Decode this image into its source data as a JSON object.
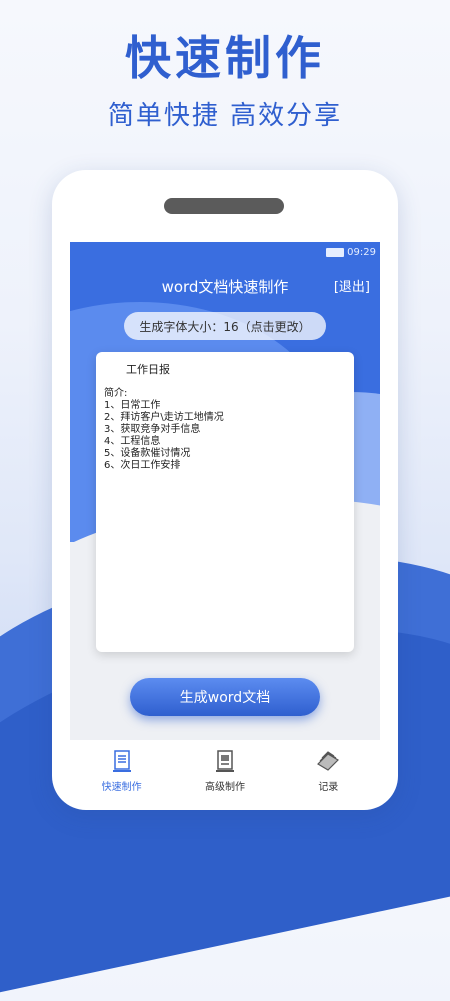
{
  "hero": {
    "title": "快速制作",
    "subtitle": "简单快捷 高效分享"
  },
  "status_bar": {
    "time": "09:29",
    "icons": [
      "battery-icon"
    ]
  },
  "app_bar": {
    "title": "word文档快速制作",
    "exit_label": "[退出]"
  },
  "font_setting": {
    "label": "生成字体大小：16（点击更改）"
  },
  "document": {
    "title": "工作日报",
    "lines": [
      "简介:",
      "1、日常工作",
      "2、拜访客户\\走访工地情况",
      "3、获取竞争对手信息",
      "4、工程信息",
      "5、设备款催讨情况",
      "6、次日工作安排"
    ]
  },
  "generate_button": {
    "label": "生成word文档"
  },
  "tabs": [
    {
      "label": "快速制作",
      "icon": "document-icon",
      "active": true
    },
    {
      "label": "高级制作",
      "icon": "template-icon",
      "active": false
    },
    {
      "label": "记录",
      "icon": "records-icon",
      "active": false
    }
  ],
  "colors": {
    "accent": "#3a6ee0",
    "hero_text": "#2f5fcf"
  }
}
